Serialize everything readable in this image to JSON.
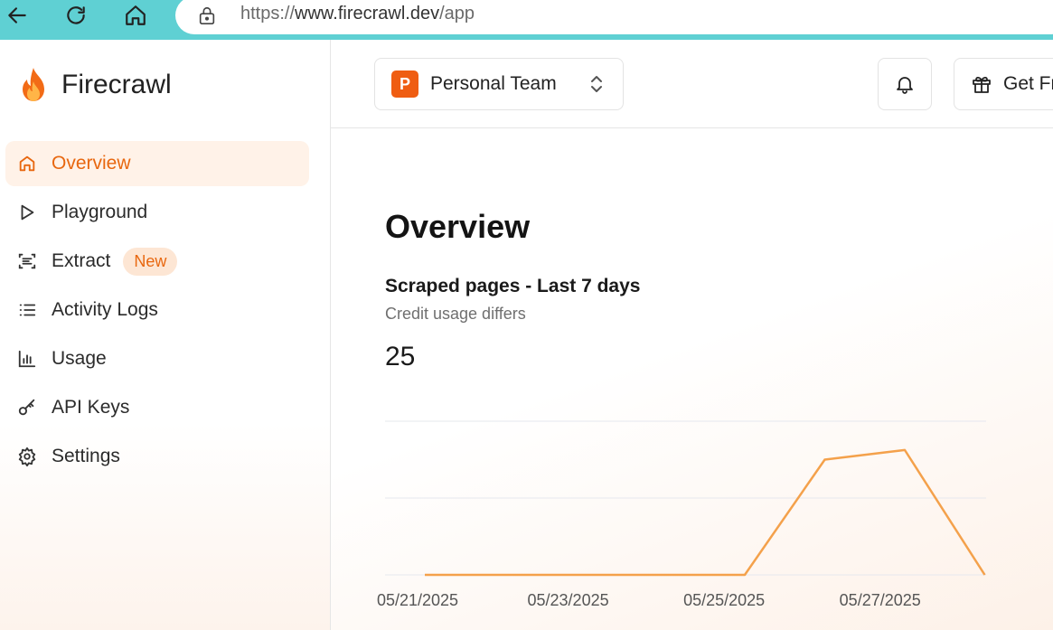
{
  "browser": {
    "url_scheme": "https://",
    "url_host": "www.firecrawl.dev",
    "url_path": "/app",
    "icons": [
      "back-icon",
      "reload-icon",
      "home-icon",
      "lock-icon"
    ]
  },
  "sidebar": {
    "brand": "Firecrawl",
    "items": [
      {
        "label": "Overview",
        "icon": "home-icon",
        "active": true
      },
      {
        "label": "Playground",
        "icon": "play-icon"
      },
      {
        "label": "Extract",
        "icon": "scan-text-icon",
        "badge": "New"
      },
      {
        "label": "Activity Logs",
        "icon": "list-icon"
      },
      {
        "label": "Usage",
        "icon": "bar-chart-icon"
      },
      {
        "label": "API Keys",
        "icon": "key-icon"
      },
      {
        "label": "Settings",
        "icon": "gear-icon"
      }
    ]
  },
  "header": {
    "team_initial": "P",
    "team_name": "Personal Team",
    "gift_label": "Get Fr"
  },
  "main": {
    "title": "Overview",
    "card_title": "Scraped pages - Last 7 days",
    "card_subtitle": "Credit usage differs",
    "card_value": "25"
  },
  "colors": {
    "accent": "#e8670f",
    "line": "#f4a14b",
    "browser_bar": "#5fd0d3"
  },
  "chart_data": {
    "type": "line",
    "x": [
      "05/21/2025",
      "05/22/2025",
      "05/23/2025",
      "05/24/2025",
      "05/25/2025",
      "05/26/2025",
      "05/27/2025",
      "05/28/2025"
    ],
    "values": [
      0,
      0,
      0,
      0,
      0,
      12,
      13,
      0
    ],
    "tick_labels": [
      "05/21/2025",
      "05/23/2025",
      "05/25/2025",
      "05/27/2025"
    ],
    "ylim": [
      0,
      16
    ],
    "grid": true
  }
}
